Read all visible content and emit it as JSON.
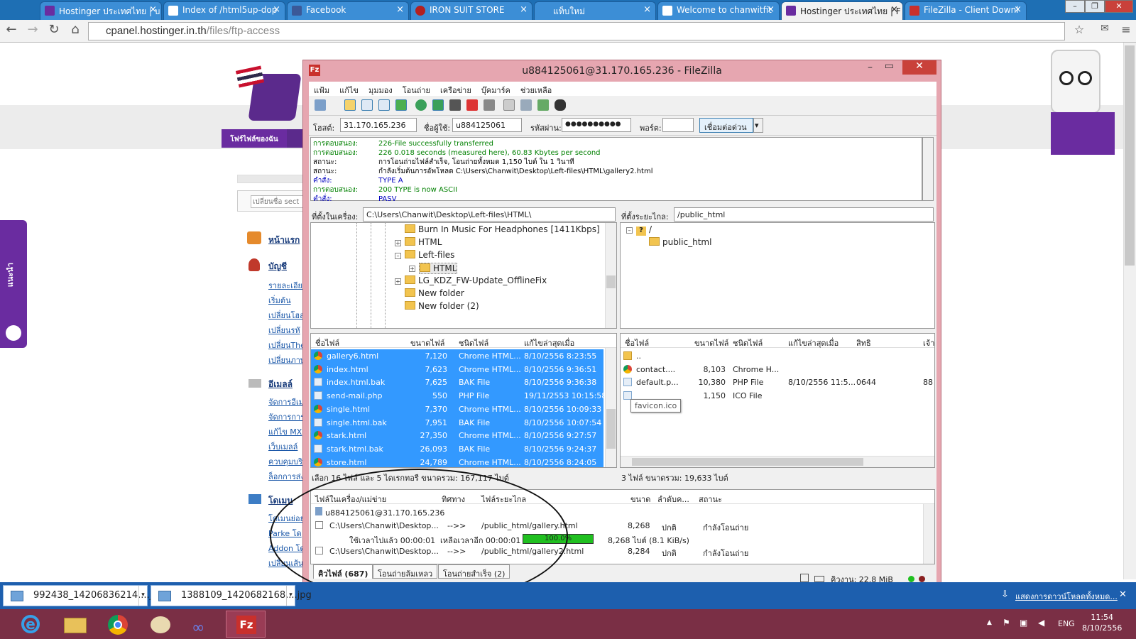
{
  "browser": {
    "tabs": [
      {
        "label": "Hostinger ประเทศไทย | บ",
        "color": "#6a2ca0"
      },
      {
        "label": "Index of /html5up-dop",
        "color": "#ffffff"
      },
      {
        "label": "Facebook",
        "color": "#3b5998"
      },
      {
        "label": "IRON SUIT STORE",
        "color": "#b32020"
      },
      {
        "label": "แท็บใหม่",
        "color": "#dddddd"
      },
      {
        "label": "Welcome to chanwitfit",
        "color": "#ffffff"
      },
      {
        "label": "Hostinger ประเทศไทย | F",
        "color": "#6a2ca0"
      },
      {
        "label": "FileZilla - Client Downl",
        "color": "#c9302c"
      }
    ],
    "url_host": "cpanel.hostinger.in.th",
    "url_path": "/files/ftp-access"
  },
  "hostinger": {
    "nav_button": "โฟร์ไฟล์ของฉัน",
    "side_tab": "แนะนำ",
    "search_placeholder": "เปลี่ยนชื่อ sect",
    "sections": [
      {
        "title": "หน้าแรก",
        "links": []
      },
      {
        "title": "บัญชี",
        "links": [
          "รายละเอียด",
          "เริ่มต้น",
          "เปลี่ยนโฮส",
          "เปลี่ยนรหั",
          "เปลี่ยนThe",
          "เปลี่ยนภาษ"
        ]
      },
      {
        "title": "อีเมลล์",
        "links": [
          "จัดการอีเม",
          "จัดการการ",
          "แก้ไข MX",
          "เว็บเมลล์",
          "ควบคุมบริ",
          "ล็อกการส่ง"
        ]
      },
      {
        "title": "โดเมน",
        "links": [
          "โดเมนย่อย",
          "Parke โด",
          "Addon โด",
          "เปลี่ยนเส้น"
        ]
      }
    ]
  },
  "filezilla": {
    "title": "u884125061@31.170.165.236 - FileZilla",
    "menu": [
      "แฟ้ม",
      "แก้ไข",
      "มุมมอง",
      "โอนถ่าย",
      "เครือข่าย",
      "บุ๊คมาร์ค",
      "ช่วยเหลือ"
    ],
    "quickconnect": {
      "host_label": "โฮสต์:",
      "host": "31.170.165.236",
      "user_label": "ชื่อผู้ใช้:",
      "user": "u884125061",
      "pass_label": "รหัสผ่าน:",
      "pass": "●●●●●●●●●●",
      "port_label": "พอร์ต:",
      "port": "",
      "button": "เชื่อมต่อด่วน"
    },
    "log": [
      {
        "k": "การตอบสนอง:",
        "v": "226-File successfully transferred",
        "color": "#008000"
      },
      {
        "k": "การตอบสนอง:",
        "v": "226 0.018 seconds (measured here), 60.83 Kbytes per second",
        "color": "#008000"
      },
      {
        "k": "สถานะ:",
        "v": "การโอนถ่ายไฟล์สำเร็จ, โอนถ่ายทั้งหมด 1,150 ไบต์ ใน 1 วินาที",
        "color": "#000000"
      },
      {
        "k": "สถานะ:",
        "v": "กำลังเริ่มต้นการอัพโหลด C:\\Users\\Chanwit\\Desktop\\Left-files\\HTML\\gallery2.html",
        "color": "#000000"
      },
      {
        "k": "คำสั่ง:",
        "v": "TYPE A",
        "color": "#0000c0"
      },
      {
        "k": "การตอบสนอง:",
        "v": "200 TYPE is now ASCII",
        "color": "#008000"
      },
      {
        "k": "คำสั่ง:",
        "v": "PASV",
        "color": "#0000c0"
      }
    ],
    "local": {
      "path_label": "ที่ตั้งในเครื่อง:",
      "path": "C:\\Users\\Chanwit\\Desktop\\Left-files\\HTML\\",
      "tree": [
        "Burn In Music For Headphones [1411Kbps]",
        "HTML",
        "Left-files",
        "HTML",
        "LG_KDZ_FW-Update_OfflineFix",
        "New folder",
        "New folder (2)"
      ],
      "columns": [
        "ชื่อไฟล์",
        "ขนาดไฟล์",
        "ชนิดไฟล์",
        "แก้ไขล่าสุดเมื่อ"
      ],
      "files": [
        {
          "name": "gallery6.html",
          "size": "7,120",
          "type": "Chrome HTML...",
          "mod": "8/10/2556 8:23:55",
          "icon": "chrome"
        },
        {
          "name": "index.html",
          "size": "7,623",
          "type": "Chrome HTML...",
          "mod": "8/10/2556 9:36:51",
          "icon": "chrome"
        },
        {
          "name": "index.html.bak",
          "size": "7,625",
          "type": "BAK File",
          "mod": "8/10/2556 9:36:38",
          "icon": "doc"
        },
        {
          "name": "send-mail.php",
          "size": "550",
          "type": "PHP File",
          "mod": "19/11/2553 10:15:58",
          "icon": "doc"
        },
        {
          "name": "single.html",
          "size": "7,370",
          "type": "Chrome HTML...",
          "mod": "8/10/2556 10:09:33",
          "icon": "chrome"
        },
        {
          "name": "single.html.bak",
          "size": "7,951",
          "type": "BAK File",
          "mod": "8/10/2556 10:07:54",
          "icon": "doc"
        },
        {
          "name": "stark.html",
          "size": "27,350",
          "type": "Chrome HTML...",
          "mod": "8/10/2556 9:27:57",
          "icon": "chrome"
        },
        {
          "name": "stark.html.bak",
          "size": "26,093",
          "type": "BAK File",
          "mod": "8/10/2556 9:24:37",
          "icon": "doc"
        },
        {
          "name": "store.html",
          "size": "24,789",
          "type": "Chrome HTML...",
          "mod": "8/10/2556 8:24:05",
          "icon": "chrome"
        }
      ],
      "status": "เลือก 16 ไฟล์ และ 5 ไดเรกทอรี ขนาดรวม: 167,117 ไบต์"
    },
    "remote": {
      "path_label": "ที่ตั้งระยะไกล:",
      "path": "/public_html",
      "tree": [
        "/",
        "public_html"
      ],
      "columns": [
        "ชื่อไฟล์",
        "ขนาดไฟล์",
        "ชนิดไฟล์",
        "แก้ไขล่าสุดเมื่อ",
        "สิทธิ",
        "เจ้า"
      ],
      "files": [
        {
          "name": "..",
          "size": "",
          "type": "",
          "mod": "",
          "perm": "",
          "owner": "",
          "icon": "folder"
        },
        {
          "name": "contact....",
          "size": "8,103",
          "type": "Chrome H...",
          "mod": "",
          "perm": "",
          "owner": "",
          "icon": "chrome"
        },
        {
          "name": "default.p...",
          "size": "10,380",
          "type": "PHP File",
          "mod": "8/10/2556 11:5...",
          "perm": "0644",
          "owner": "88",
          "icon": "doc"
        },
        {
          "name": "",
          "size": "1,150",
          "type": "ICO File",
          "mod": "",
          "perm": "",
          "owner": "",
          "icon": "doc"
        }
      ],
      "tooltip": "favicon.ico",
      "status": "3 ไฟล์ ขนาดรวม: 19,633 ไบต์"
    },
    "queue": {
      "columns": [
        "ไฟล์ในเครื่อง/แม่ข่าย",
        "ทิศทาง",
        "ไฟล์ระยะไกล",
        "ขนาด",
        "ลำดับค...",
        "สถานะ"
      ],
      "server": "u884125061@31.170.165.236",
      "items": [
        {
          "local": "C:\\Users\\Chanwit\\Desktop...",
          "dir": "-->>",
          "remote": "/public_html/gallery.html",
          "size": "8,268",
          "prio": "ปกติ",
          "status": "กำลังโอนถ่าย"
        },
        {
          "local": "C:\\Users\\Chanwit\\Desktop...",
          "dir": "-->>",
          "remote": "/public_html/gallery2.html",
          "size": "8,284",
          "prio": "ปกติ",
          "status": "กำลังโอนถ่าย"
        }
      ],
      "progress": {
        "elapsed": "ใช้เวลาไปแล้ว 00:00:01",
        "left": "เหลือเวลาอีก 00:00:01",
        "percent_text": "100.0%",
        "percent": 100,
        "rate": "8,268 ไบต์ (8.1 KiB/s)"
      },
      "tabs": [
        "คิวไฟล์ (687)",
        "โอนถ่ายล้มเหลว",
        "โอนถ่ายสำเร็จ (2)"
      ],
      "queue_size": "คิวงาน: 22.8 MiB"
    }
  },
  "downloads": {
    "items": [
      "992438_14206836214....jpg",
      "1388109_1420682168....jpg"
    ],
    "show_all": "แสดงการดาวน์โหลดทั้งหมด..."
  },
  "taskbar": {
    "lang": "ENG",
    "time": "11:54",
    "date": "8/10/2556"
  }
}
